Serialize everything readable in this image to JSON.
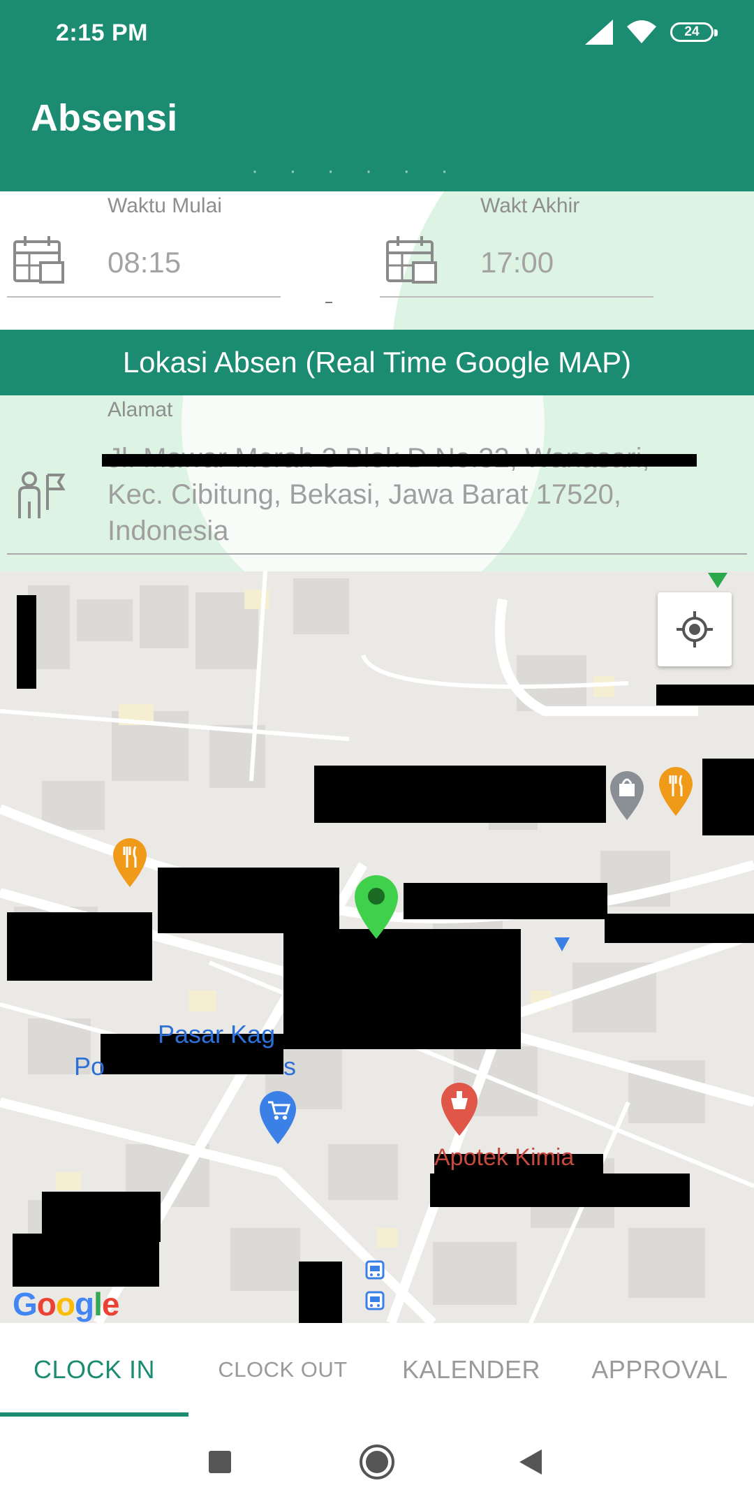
{
  "status_bar": {
    "time": "2:15 PM",
    "battery": "24"
  },
  "app_bar": {
    "title": "Absensi"
  },
  "time_section": {
    "start": {
      "label": "Waktu Mulai",
      "value": "08:15",
      "icon": "calendar-icon"
    },
    "end": {
      "label": "Wakt Akhir",
      "value": "17:00",
      "icon": "calendar-icon"
    },
    "separator": "-"
  },
  "map_header": {
    "title": "Lokasi Absen (Real Time Google MAP)"
  },
  "address": {
    "label": "Alamat",
    "value": "Jl. Mawar Merah 3 Blok D No.32, Wanasari, Kec. Cibitung, Bekasi, Jawa Barat 17520, Indonesia",
    "icon": "location-person-icon"
  },
  "map": {
    "labels": [
      "Pasar Kag",
      "Po",
      "s",
      "Apotek Kimia"
    ],
    "logo": "Google",
    "locate_button_icon": "my-location-icon"
  },
  "tabs": [
    {
      "label": "CLOCK IN",
      "active": true
    },
    {
      "label": "CLOCK OUT",
      "active": false
    },
    {
      "label": "KALENDER",
      "active": false
    },
    {
      "label": "APPROVAL",
      "active": false
    }
  ],
  "colors": {
    "primary": "#1b8c72",
    "light_green": "#ddf3e3",
    "map_bg": "#eceae6"
  }
}
